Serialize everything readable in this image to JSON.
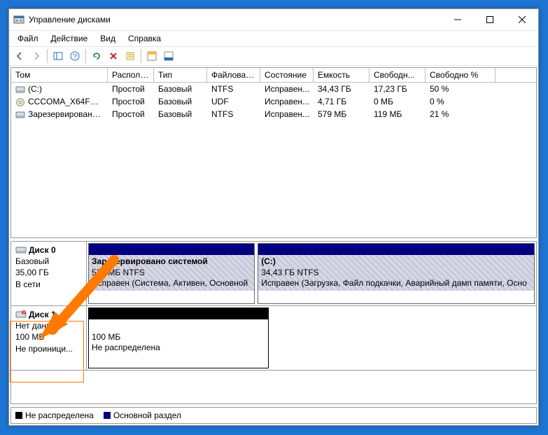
{
  "window": {
    "title": "Управление дисками"
  },
  "menu": {
    "file": "Файл",
    "action": "Действие",
    "view": "Вид",
    "help": "Справка"
  },
  "columns": [
    "Том",
    "Располо...",
    "Тип",
    "Файловая с...",
    "Состояние",
    "Емкость",
    "Свободн...",
    "Свободно %"
  ],
  "volumes": [
    {
      "icon": "drive",
      "name": "(C:)",
      "layout": "Простой",
      "type": "Базовый",
      "fs": "NTFS",
      "status": "Исправен...",
      "capacity": "34,43 ГБ",
      "free": "17,23 ГБ",
      "pct": "50 %"
    },
    {
      "icon": "cd",
      "name": "CCCOMA_X64FRE...",
      "layout": "Простой",
      "type": "Базовый",
      "fs": "UDF",
      "status": "Исправен...",
      "capacity": "4,71 ГБ",
      "free": "0 МБ",
      "pct": "0 %"
    },
    {
      "icon": "drive",
      "name": "Зарезервировано...",
      "layout": "Простой",
      "type": "Базовый",
      "fs": "NTFS",
      "status": "Исправен...",
      "capacity": "579 МБ",
      "free": "119 МБ",
      "pct": "21 %"
    }
  ],
  "disks": [
    {
      "title": "Диск 0",
      "lines": [
        "Базовый",
        "35,00 ГБ",
        "В сети"
      ],
      "icon": "disk",
      "parts": [
        {
          "kind": "primary",
          "flex": 1.8,
          "title": "Зарезервировано системой",
          "line2": "579 МБ NTFS",
          "line3": "Исправен (Система, Активен, Основной"
        },
        {
          "kind": "primary",
          "flex": 3,
          "title": "(C:)",
          "line2": "34,43 ГБ NTFS",
          "line3": "Исправен (Загрузка, Файл подкачки, Аварийный дамп памяти, Осно"
        }
      ]
    },
    {
      "title": "Диск 1",
      "lines": [
        "Нет данных",
        "100 МБ",
        "Не проиници..."
      ],
      "icon": "unknown",
      "parts": [
        {
          "kind": "unalloc",
          "flex": 1,
          "title": "",
          "line2": "100 МБ",
          "line3": "Не распределена"
        }
      ],
      "partWidth": "258px"
    }
  ],
  "legend": {
    "unalloc": "Не распределена",
    "primary": "Основной раздел"
  }
}
